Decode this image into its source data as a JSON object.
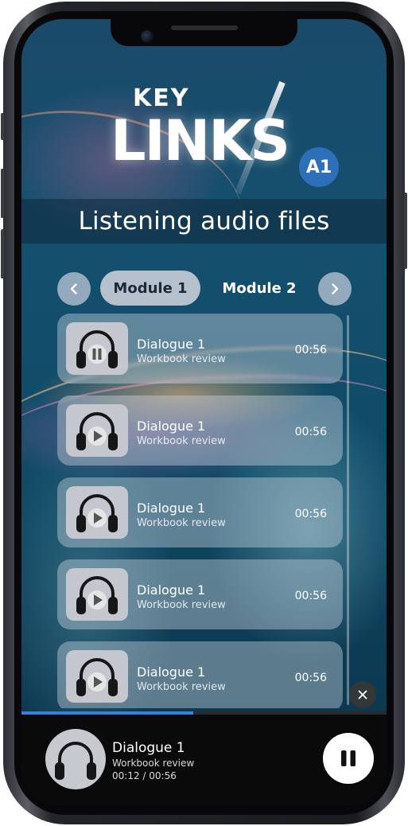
{
  "app": {
    "logo_key": "KEY",
    "logo_links": "LINKS",
    "level": "A1",
    "title": "Listening audio files"
  },
  "nav": {
    "prev_icon": "chevron-left-icon",
    "next_icon": "chevron-right-icon",
    "tabs": [
      {
        "label": "Module 1",
        "active": true
      },
      {
        "label": "Module 2",
        "active": false
      }
    ]
  },
  "tracks": [
    {
      "title": "Dialogue 1",
      "subtitle": "Workbook review",
      "duration": "00:56",
      "state": "playing",
      "icon": "pause-icon"
    },
    {
      "title": "Dialogue 1",
      "subtitle": "Workbook review",
      "duration": "00:56",
      "state": "stopped",
      "icon": "play-icon"
    },
    {
      "title": "Dialogue 1",
      "subtitle": "Workbook review",
      "duration": "00:56",
      "state": "stopped",
      "icon": "play-icon"
    },
    {
      "title": "Dialogue 1",
      "subtitle": "Workbook review",
      "duration": "00:56",
      "state": "stopped",
      "icon": "play-icon"
    },
    {
      "title": "Dialogue 1",
      "subtitle": "Workbook review",
      "duration": "00:56",
      "state": "stopped",
      "icon": "play-icon"
    }
  ],
  "player": {
    "title": "Dialogue 1",
    "subtitle": "Workbook review",
    "time": "00:12 / 00:56",
    "progress_fraction": 0.47,
    "control_icon": "pause-icon"
  },
  "colors": {
    "level_badge": "#2d6fb8",
    "progress": "#3a7fd8",
    "player_bg": "#0a0a0b"
  }
}
